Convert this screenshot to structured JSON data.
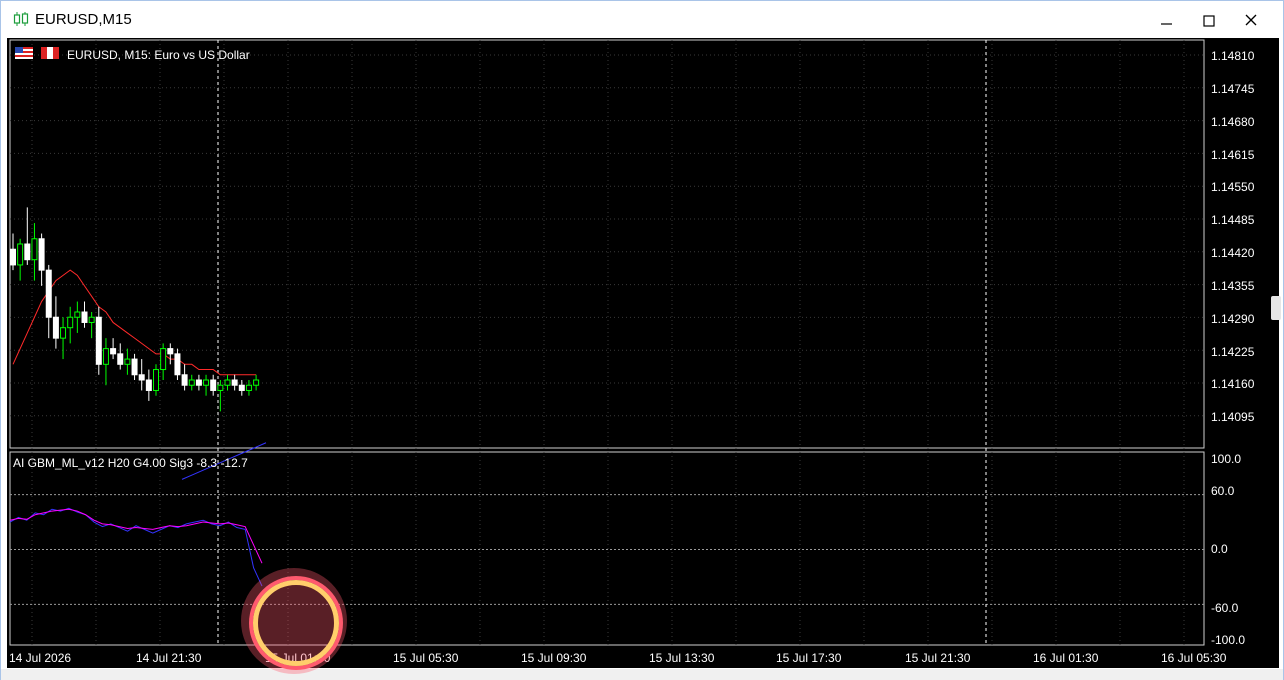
{
  "window": {
    "title": "EURUSD,M15",
    "icon": "candlestick-chart-icon",
    "controls": [
      "minimize-icon",
      "maximize-icon",
      "close-icon"
    ]
  },
  "chart": {
    "symbol_label": "EURUSD, M15:  Euro vs US Dollar",
    "indicator_label": "AI GBM_ML_v12 H20 G4.00 Sig3 -8.3 -12.7",
    "colors": {
      "background": "#000000",
      "grid": "#3a3a3a",
      "bull_candle": "#00ff00",
      "bear_candle": "#ffffff",
      "moving_average": "#ff2a2a",
      "indicator_line_a": "#3333ff",
      "indicator_line_b": "#ff00ff",
      "period_separator": "#ffffff"
    },
    "price_axis": [
      "1.14810",
      "1.14745",
      "1.14680",
      "1.14615",
      "1.14550",
      "1.14485",
      "1.14420",
      "1.14355",
      "1.14290",
      "1.14225",
      "1.14160",
      "1.14095"
    ],
    "indicator_axis": [
      "100.0",
      "60.0",
      "0.0",
      "-60.0",
      "-100.0"
    ],
    "time_axis": [
      "14 Jul 2026",
      "14 Jul 21:30",
      "15 Jul 01:30",
      "15 Jul 05:30",
      "15 Jul 09:30",
      "15 Jul 13:30",
      "15 Jul 17:30",
      "15 Jul 21:30",
      "16 Jul 01:30",
      "16 Jul 05:30"
    ]
  },
  "chart_data": {
    "type": "candlestick",
    "title": "EURUSD, M15:  Euro vs US Dollar",
    "ylim": [
      1.1406,
      1.1484
    ],
    "candles": [
      {
        "o": 1.1444,
        "h": 1.1447,
        "l": 1.144,
        "c": 1.1441
      },
      {
        "o": 1.1441,
        "h": 1.1446,
        "l": 1.1438,
        "c": 1.1445
      },
      {
        "o": 1.1445,
        "h": 1.1452,
        "l": 1.1441,
        "c": 1.1442
      },
      {
        "o": 1.1442,
        "h": 1.1449,
        "l": 1.1438,
        "c": 1.1446
      },
      {
        "o": 1.1446,
        "h": 1.1447,
        "l": 1.1437,
        "c": 1.144
      },
      {
        "o": 1.144,
        "h": 1.1441,
        "l": 1.1427,
        "c": 1.1431
      },
      {
        "o": 1.1431,
        "h": 1.1435,
        "l": 1.1425,
        "c": 1.1427
      },
      {
        "o": 1.1427,
        "h": 1.1431,
        "l": 1.1423,
        "c": 1.1429
      },
      {
        "o": 1.1429,
        "h": 1.1433,
        "l": 1.1426,
        "c": 1.1431
      },
      {
        "o": 1.1431,
        "h": 1.1434,
        "l": 1.1428,
        "c": 1.1432
      },
      {
        "o": 1.1432,
        "h": 1.1434,
        "l": 1.1429,
        "c": 1.143
      },
      {
        "o": 1.143,
        "h": 1.1432,
        "l": 1.1427,
        "c": 1.1431
      },
      {
        "o": 1.1431,
        "h": 1.1433,
        "l": 1.142,
        "c": 1.1422
      },
      {
        "o": 1.1422,
        "h": 1.1427,
        "l": 1.1418,
        "c": 1.1425
      },
      {
        "o": 1.1425,
        "h": 1.1427,
        "l": 1.1423,
        "c": 1.1424
      },
      {
        "o": 1.1424,
        "h": 1.1426,
        "l": 1.1421,
        "c": 1.1422
      },
      {
        "o": 1.1422,
        "h": 1.1425,
        "l": 1.142,
        "c": 1.1423
      },
      {
        "o": 1.1423,
        "h": 1.1424,
        "l": 1.1419,
        "c": 1.142
      },
      {
        "o": 1.142,
        "h": 1.1423,
        "l": 1.1417,
        "c": 1.1419
      },
      {
        "o": 1.1419,
        "h": 1.1421,
        "l": 1.1415,
        "c": 1.1417
      },
      {
        "o": 1.1417,
        "h": 1.1422,
        "l": 1.1416,
        "c": 1.1421
      },
      {
        "o": 1.1421,
        "h": 1.1426,
        "l": 1.1419,
        "c": 1.1425
      },
      {
        "o": 1.1425,
        "h": 1.1426,
        "l": 1.1422,
        "c": 1.1424
      },
      {
        "o": 1.1424,
        "h": 1.1425,
        "l": 1.1419,
        "c": 1.142
      },
      {
        "o": 1.142,
        "h": 1.1422,
        "l": 1.1417,
        "c": 1.1418
      },
      {
        "o": 1.1418,
        "h": 1.142,
        "l": 1.1417,
        "c": 1.1419
      },
      {
        "o": 1.1419,
        "h": 1.142,
        "l": 1.1417,
        "c": 1.1418
      },
      {
        "o": 1.1418,
        "h": 1.142,
        "l": 1.1416,
        "c": 1.1419
      },
      {
        "o": 1.1419,
        "h": 1.142,
        "l": 1.1416,
        "c": 1.1417
      },
      {
        "o": 1.1417,
        "h": 1.1419,
        "l": 1.1413,
        "c": 1.1418
      },
      {
        "o": 1.1418,
        "h": 1.142,
        "l": 1.1417,
        "c": 1.1419
      },
      {
        "o": 1.1419,
        "h": 1.142,
        "l": 1.1417,
        "c": 1.1418
      },
      {
        "o": 1.1418,
        "h": 1.1419,
        "l": 1.1416,
        "c": 1.1417
      },
      {
        "o": 1.1417,
        "h": 1.1419,
        "l": 1.1416,
        "c": 1.1418
      },
      {
        "o": 1.1418,
        "h": 1.142,
        "l": 1.1417,
        "c": 1.1419
      }
    ],
    "moving_average": [
      1.1422,
      1.1425,
      1.1428,
      1.1431,
      1.1434,
      1.1436,
      1.1438,
      1.1439,
      1.144,
      1.1439,
      1.1437,
      1.1435,
      1.1433,
      1.1432,
      1.143,
      1.1429,
      1.1428,
      1.1427,
      1.1426,
      1.1425,
      1.1424,
      1.1424,
      1.1423,
      1.1423,
      1.1422,
      1.1422,
      1.1421,
      1.1421,
      1.1421,
      1.142,
      1.142,
      1.142,
      1.142,
      1.142,
      1.142
    ],
    "lower_line": [
      1.14,
      1.1401,
      1.1402,
      1.1403,
      1.1404,
      1.1405,
      1.1406,
      1.1407
    ],
    "indicator": {
      "ylim": [
        -100,
        100
      ],
      "series": [
        {
          "values": [
            30,
            35,
            32,
            40,
            38,
            44,
            42,
            45,
            41,
            38,
            30,
            25,
            28,
            24,
            20,
            26,
            22,
            18,
            22,
            26,
            24,
            28,
            30,
            32,
            28,
            26,
            30,
            24,
            22,
            -20,
            -40
          ]
        },
        {
          "values": [
            32,
            34,
            33,
            38,
            40,
            42,
            43,
            44,
            42,
            38,
            32,
            28,
            27,
            25,
            23,
            24,
            23,
            22,
            24,
            26,
            25,
            26,
            28,
            30,
            29,
            28,
            29,
            27,
            25,
            5,
            -15
          ]
        }
      ]
    }
  }
}
